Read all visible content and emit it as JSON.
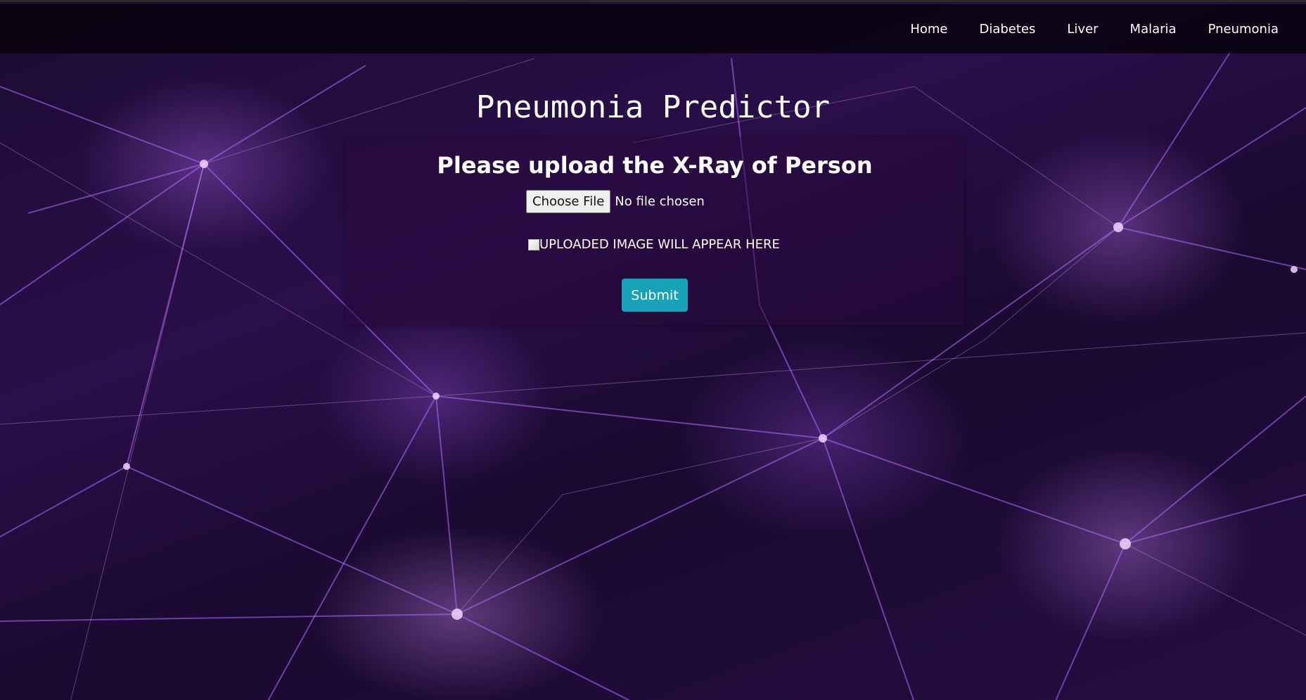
{
  "nav": {
    "items": [
      {
        "label": "Home"
      },
      {
        "label": "Diabetes"
      },
      {
        "label": "Liver"
      },
      {
        "label": "Malaria"
      },
      {
        "label": "Pneumonia"
      }
    ]
  },
  "page": {
    "title": "Pneumonia Predictor"
  },
  "form": {
    "heading": "Please upload the X-Ray of Person",
    "file_button_label": "Choose File",
    "file_status": "No file chosen",
    "image_alt": "UPLOADED IMAGE WILL APPEAR HERE",
    "submit_label": "Submit"
  },
  "colors": {
    "submit_bg": "#17a2b8",
    "navbar_bg": "#06020c",
    "background_accent": "#a855f7"
  }
}
